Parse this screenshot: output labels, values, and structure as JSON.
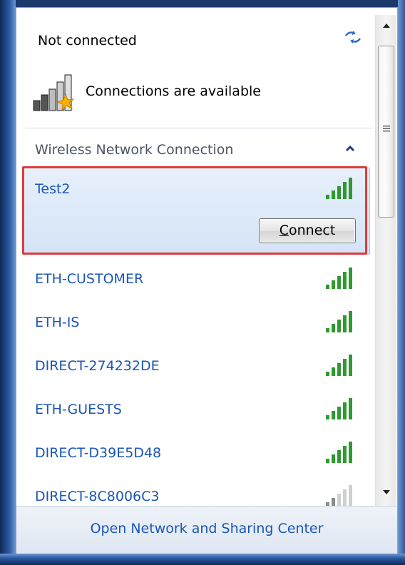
{
  "status": {
    "title": "Not connected",
    "availability": "Connections are available"
  },
  "section": {
    "title": "Wireless Network Connection"
  },
  "selected_network": {
    "name": "Test2",
    "connect_label_prefix": "C",
    "connect_label_rest": "onnect"
  },
  "networks": [
    {
      "name": "ETH-CUSTOMER",
      "signal": "full"
    },
    {
      "name": "ETH-IS",
      "signal": "full"
    },
    {
      "name": "DIRECT-274232DE",
      "signal": "full"
    },
    {
      "name": "ETH-GUESTS",
      "signal": "full"
    },
    {
      "name": "DIRECT-D39E5D48",
      "signal": "full"
    },
    {
      "name": "DIRECT-8C8006C3",
      "signal": "weak"
    }
  ],
  "footer": {
    "link": "Open Network and Sharing Center"
  },
  "colors": {
    "link_blue": "#1a56b6",
    "signal_green": "#2f9a2f",
    "highlight_red": "#e03b3b"
  },
  "icons": [
    "refresh-icon",
    "wireless-connections-icon",
    "chevron-up-icon",
    "signal-strength-icon",
    "scroll-up-icon",
    "scroll-down-icon"
  ]
}
